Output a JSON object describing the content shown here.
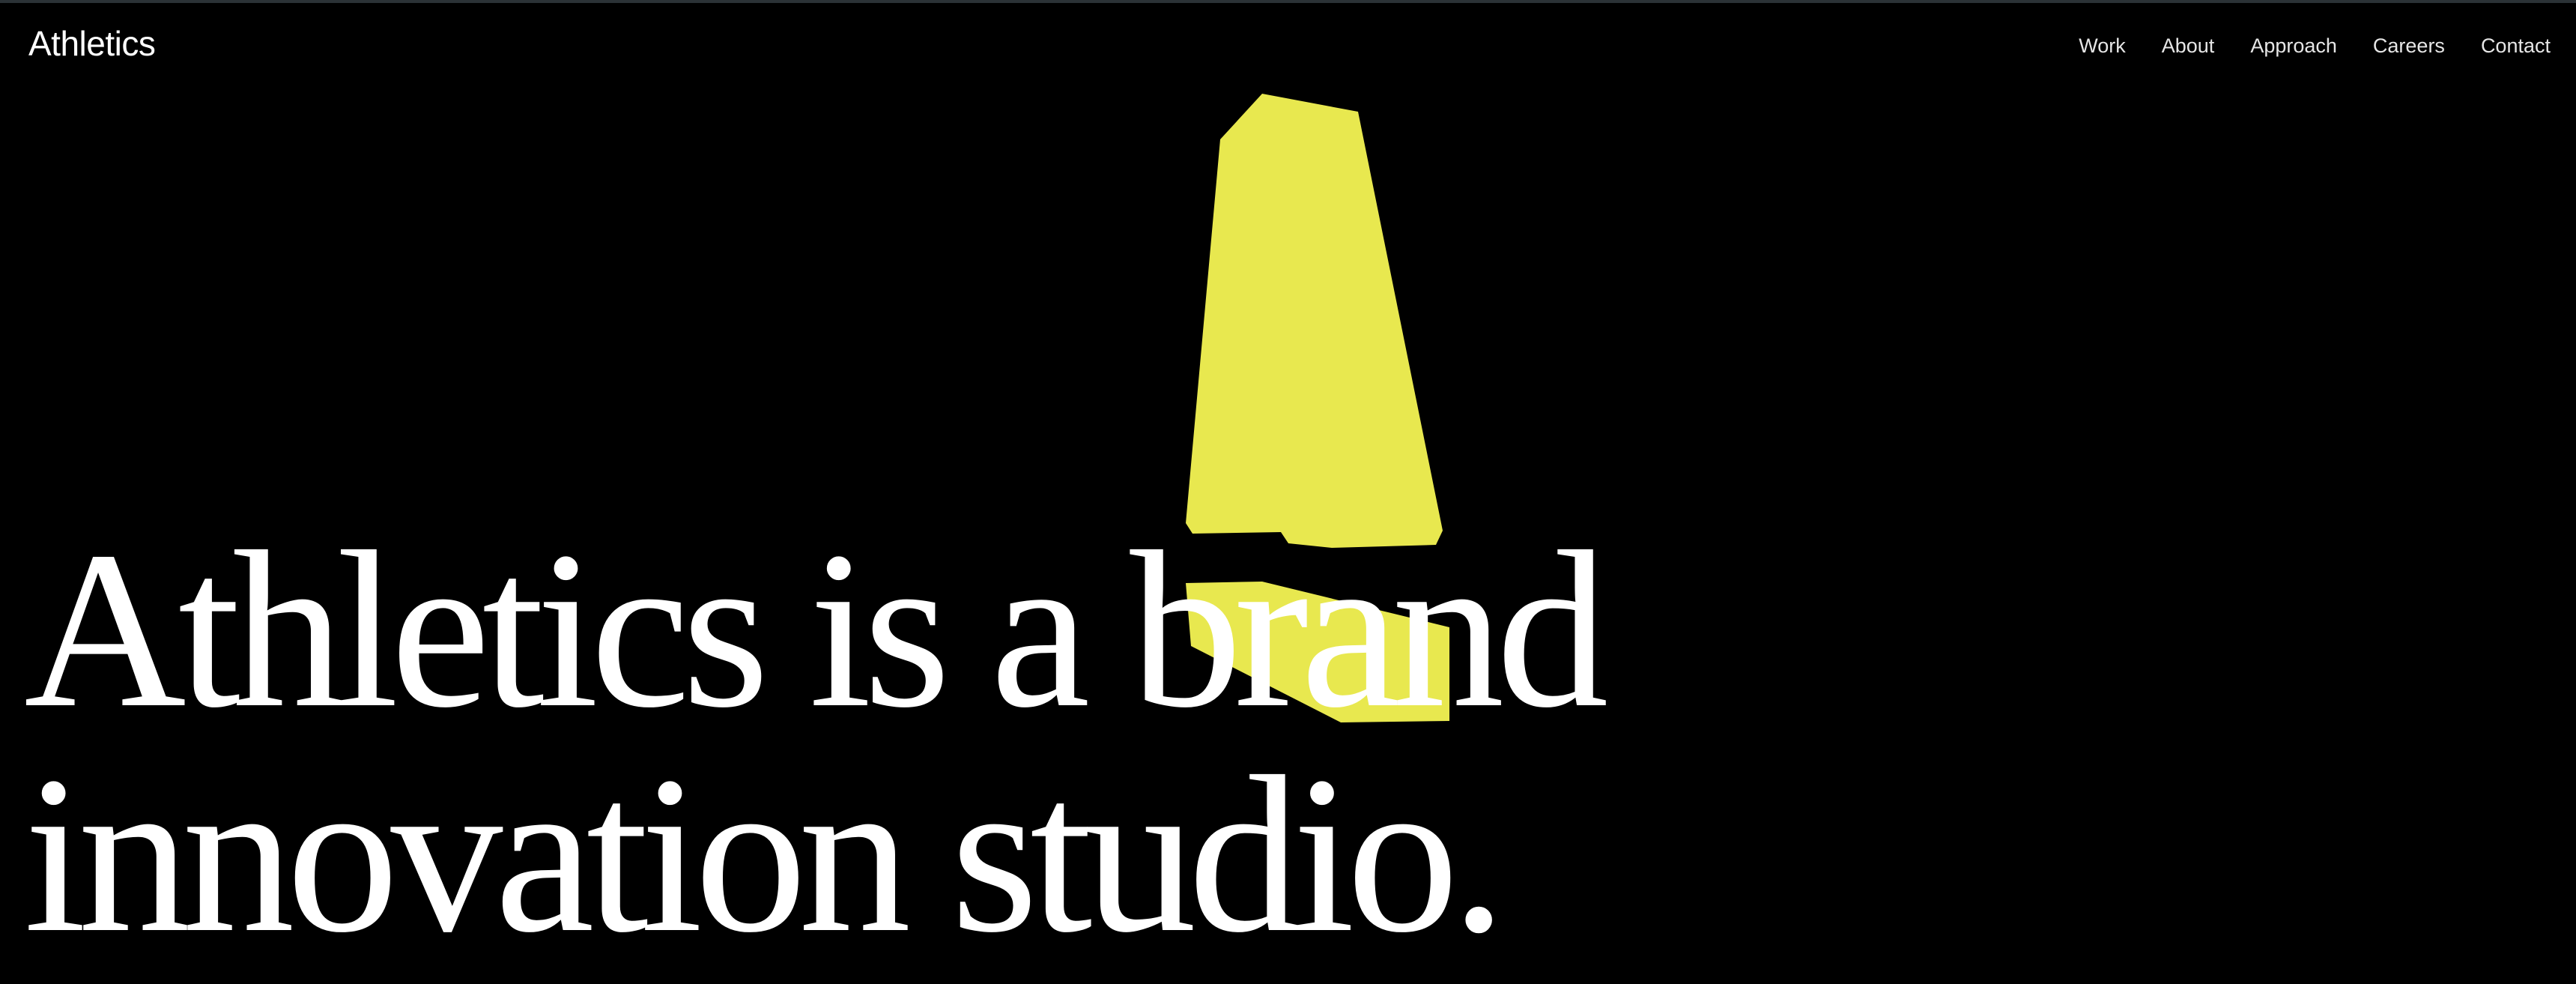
{
  "colors": {
    "background": "#000000",
    "text": "#ffffff",
    "accent": "#e8e84f"
  },
  "header": {
    "logo": "Athletics",
    "nav": [
      "Work",
      "About",
      "Approach",
      "Careers",
      "Contact"
    ]
  },
  "hero": {
    "headline_line1": "Athletics is a brand",
    "headline_line2": "innovation studio.",
    "artwork_icon": "yellow-3d-shape-icon"
  }
}
